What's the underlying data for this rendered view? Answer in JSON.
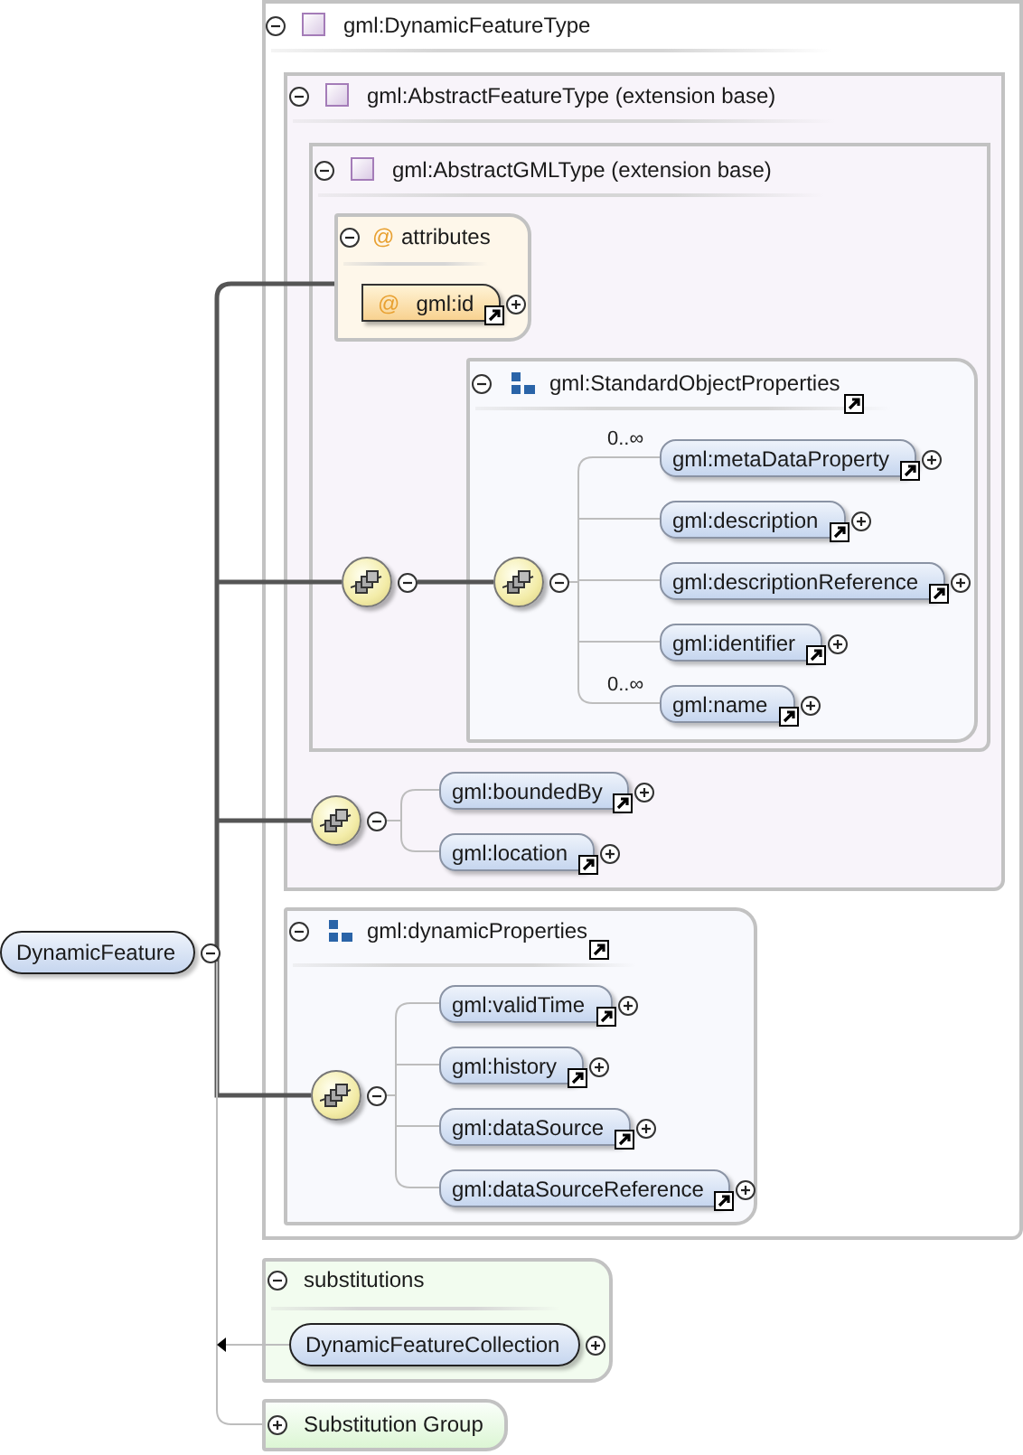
{
  "root_element": {
    "name": "DynamicFeature",
    "expanded": true
  },
  "complex_type": {
    "name": "gml:DynamicFeatureType",
    "expanded": true,
    "base": {
      "name": "gml:AbstractFeatureType (extension base)",
      "expanded": true,
      "base": {
        "name": "gml:AbstractGMLType (extension base)",
        "expanded": true,
        "attributes": {
          "label": "attributes",
          "marker": "@",
          "expanded": true,
          "items": [
            {
              "marker": "@",
              "name": "gml:id",
              "expanded": false
            }
          ]
        },
        "sequence": {
          "expanded": true
        },
        "group": {
          "name": "gml:StandardObjectProperties",
          "expanded": true,
          "sequence": {
            "expanded": true
          },
          "elements": [
            {
              "name": "gml:metaDataProperty",
              "occurs": "0..∞",
              "expanded": false
            },
            {
              "name": "gml:description",
              "expanded": false
            },
            {
              "name": "gml:descriptionReference",
              "expanded": false
            },
            {
              "name": "gml:identifier",
              "expanded": false
            },
            {
              "name": "gml:name",
              "occurs": "0..∞",
              "expanded": false
            }
          ]
        }
      },
      "sequence": {
        "expanded": true,
        "elements": [
          {
            "name": "gml:boundedBy",
            "expanded": false
          },
          {
            "name": "gml:location",
            "expanded": false
          }
        ]
      }
    },
    "group": {
      "name": "gml:dynamicProperties",
      "expanded": true,
      "sequence": {
        "expanded": true
      },
      "elements": [
        {
          "name": "gml:validTime",
          "expanded": false
        },
        {
          "name": "gml:history",
          "expanded": false
        },
        {
          "name": "gml:dataSource",
          "expanded": false
        },
        {
          "name": "gml:dataSourceReference",
          "expanded": false
        }
      ]
    }
  },
  "substitutions": {
    "label": "substitutions",
    "expanded": true,
    "elements": [
      {
        "name": "DynamicFeatureCollection",
        "expanded": false
      }
    ]
  },
  "substitution_group": {
    "label": "Substitution Group",
    "expanded": false
  }
}
